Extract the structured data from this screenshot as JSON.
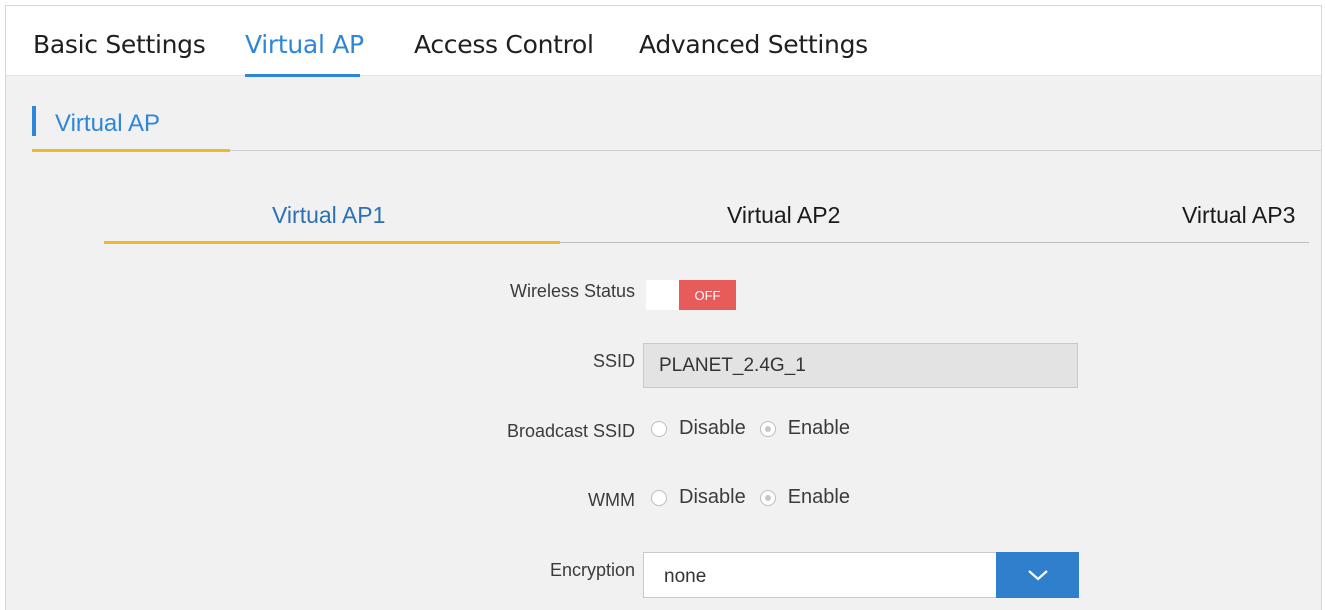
{
  "nav": {
    "tabs": [
      {
        "label": "Basic Settings"
      },
      {
        "label": "Virtual AP"
      },
      {
        "label": "Access Control"
      },
      {
        "label": "Advanced Settings"
      }
    ],
    "active_tab": "Virtual AP"
  },
  "section": {
    "title": "Virtual AP"
  },
  "subtabs": [
    {
      "label": "Virtual AP1"
    },
    {
      "label": "Virtual AP2"
    },
    {
      "label": "Virtual AP3"
    }
  ],
  "form": {
    "wireless_status": {
      "label": "Wireless Status",
      "state": "OFF"
    },
    "ssid": {
      "label": "SSID",
      "value": "PLANET_2.4G_1"
    },
    "broadcast_ssid": {
      "label": "Broadcast SSID",
      "options": [
        "Disable",
        "Enable"
      ],
      "selected": "Enable"
    },
    "wmm": {
      "label": "WMM",
      "options": [
        "Disable",
        "Enable"
      ],
      "selected": "Enable"
    },
    "encryption": {
      "label": "Encryption",
      "value": "none"
    }
  },
  "colors": {
    "accent": "#2d86d9",
    "highlight": "#f1b82e",
    "off": "#e85b5b",
    "dropdown": "#2f7fcd"
  }
}
